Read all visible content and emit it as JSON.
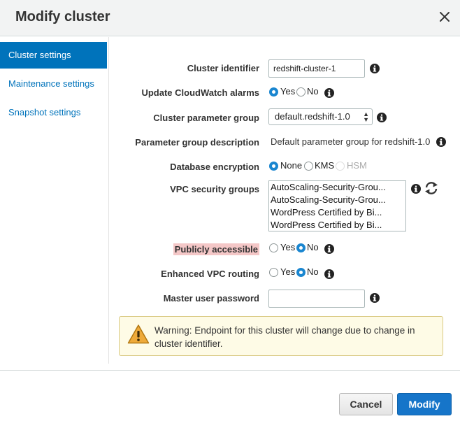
{
  "dialog": {
    "title": "Modify cluster"
  },
  "sidebar": {
    "items": [
      {
        "label": "Cluster settings"
      },
      {
        "label": "Maintenance settings"
      },
      {
        "label": "Snapshot settings"
      }
    ]
  },
  "form": {
    "cluster_identifier": {
      "label": "Cluster identifier",
      "value": "redshift-cluster-1"
    },
    "cloudwatch": {
      "label": "Update CloudWatch alarms",
      "options": [
        "Yes",
        "No"
      ],
      "selected": "Yes"
    },
    "parameter_group": {
      "label": "Cluster parameter group",
      "value": "default.redshift-1.0"
    },
    "parameter_group_description": {
      "label": "Parameter group description",
      "value": "Default parameter group for redshift-1.0"
    },
    "encryption": {
      "label": "Database encryption",
      "options": [
        "None",
        "KMS",
        "HSM"
      ],
      "selected": "None",
      "disabled": [
        "HSM"
      ]
    },
    "vpc_security_groups": {
      "label": "VPC security groups",
      "items": [
        "AutoScaling-Security-Grou...",
        "AutoScaling-Security-Grou...",
        "WordPress Certified by Bi...",
        "WordPress Certified by Bi..."
      ]
    },
    "publicly_accessible": {
      "label": "Publicly accessible",
      "options": [
        "Yes",
        "No"
      ],
      "selected": "No"
    },
    "enhanced_vpc_routing": {
      "label": "Enhanced VPC routing",
      "options": [
        "Yes",
        "No"
      ],
      "selected": "No"
    },
    "master_password": {
      "label": "Master user password",
      "value": ""
    }
  },
  "warning": {
    "text": "Warning: Endpoint for this cluster will change due to change in cluster identifier."
  },
  "footer": {
    "cancel_label": "Cancel",
    "modify_label": "Modify"
  },
  "colors": {
    "accent": "#0073bb",
    "primary_button": "#1675c9",
    "warning_bg": "#fefbe6",
    "highlight": "#f4c7c7"
  }
}
